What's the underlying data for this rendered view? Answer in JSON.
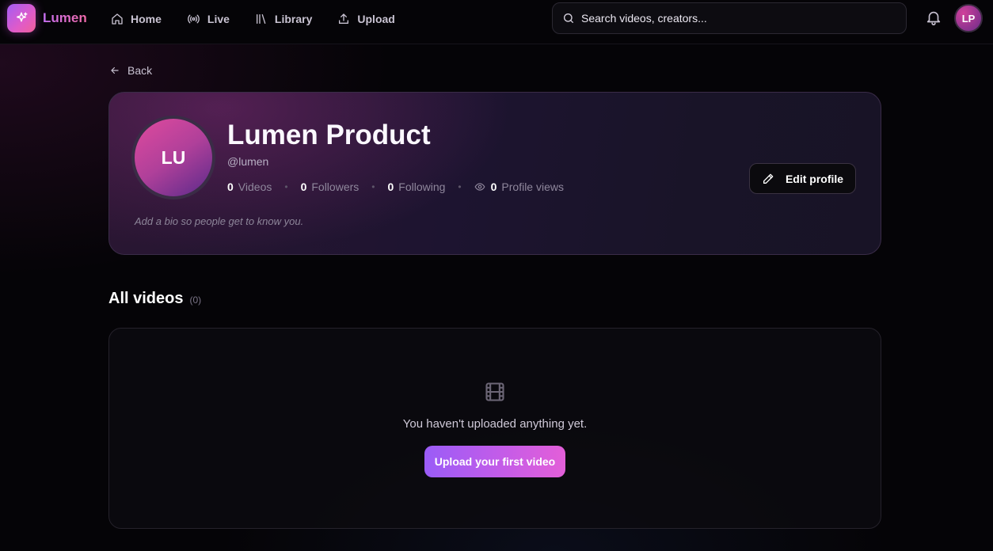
{
  "app": {
    "name": "Lumen",
    "logo_icon": "sparkles-icon"
  },
  "nav": {
    "items": [
      {
        "label": "Home",
        "icon": "home-icon"
      },
      {
        "label": "Live",
        "icon": "broadcast-icon"
      },
      {
        "label": "Library",
        "icon": "library-icon"
      },
      {
        "label": "Upload",
        "icon": "upload-icon"
      }
    ]
  },
  "search": {
    "placeholder": "Search videos, creators..."
  },
  "user": {
    "initials": "LP"
  },
  "back": {
    "label": "Back"
  },
  "profile": {
    "initials": "LU",
    "name": "Lumen Product",
    "handle": "@lumen",
    "stats": {
      "videos": {
        "value": "0",
        "label": "Videos"
      },
      "followers": {
        "value": "0",
        "label": "Followers"
      },
      "following": {
        "value": "0",
        "label": "Following"
      },
      "views": {
        "value": "0",
        "label": "Profile views"
      }
    },
    "bio_placeholder": "Add a bio so people get to know you.",
    "edit_label": "Edit profile"
  },
  "videos": {
    "title": "All videos",
    "count": "(0)",
    "empty_text": "You haven't uploaded anything yet.",
    "upload_label": "Upload your first video"
  },
  "colors": {
    "accent_start": "#9a5cf7",
    "accent_end": "#e35fd8",
    "background": "#050407"
  }
}
